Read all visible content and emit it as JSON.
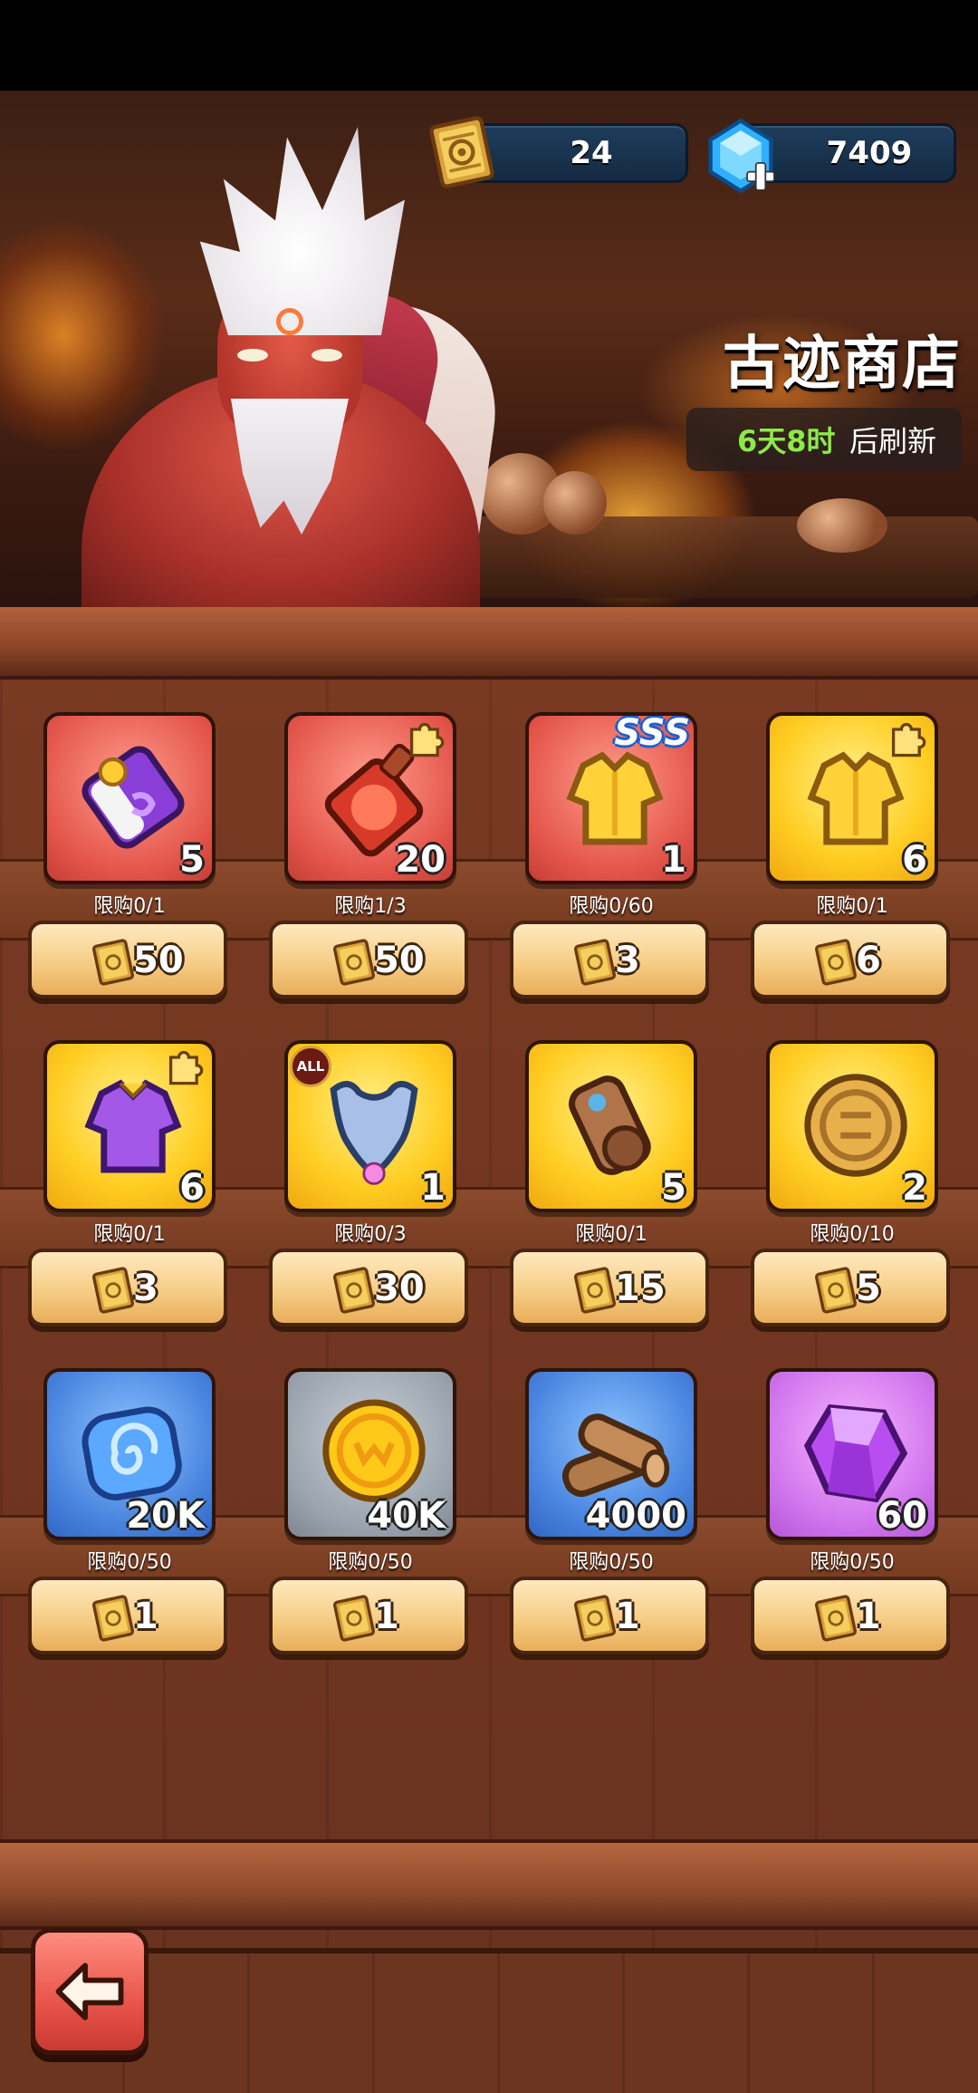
{
  "currency": {
    "tickets": "24",
    "gems": "7409",
    "ticket_icon": "relic-ticket-icon",
    "gem_icon": "blue-gem-icon"
  },
  "shop": {
    "title": "古迹商店",
    "refresh_time": "6天8时",
    "refresh_label": "后刷新"
  },
  "items": [
    {
      "qty": "5",
      "limit": "限购0/1",
      "price": "50",
      "icon": "purple-scroll-icon"
    },
    {
      "qty": "20",
      "limit": "限购1/3",
      "price": "50",
      "icon": "red-potion-shard-icon"
    },
    {
      "qty": "1",
      "limit": "限购0/60",
      "price": "3",
      "icon": "gold-armor-shard-icon",
      "badge": "SSS"
    },
    {
      "qty": "6",
      "limit": "限购0/1",
      "price": "6",
      "icon": "gold-armor-shard-icon"
    },
    {
      "qty": "6",
      "limit": "限购0/1",
      "price": "3",
      "icon": "purple-armor-shard-icon"
    },
    {
      "qty": "1",
      "limit": "限购0/3",
      "price": "30",
      "icon": "blue-armor-icon",
      "badge": "ALL"
    },
    {
      "qty": "5",
      "limit": "限购0/1",
      "price": "15",
      "icon": "brown-scroll-icon"
    },
    {
      "qty": "2",
      "limit": "限购0/10",
      "price": "5",
      "icon": "gold-coin-icon"
    },
    {
      "qty": "20K",
      "limit": "限购0/50",
      "price": "1",
      "icon": "blue-swirl-stone-icon"
    },
    {
      "qty": "40K",
      "limit": "限购0/50",
      "price": "1",
      "icon": "gold-coin-icon"
    },
    {
      "qty": "4000",
      "limit": "限购0/50",
      "price": "1",
      "icon": "wood-log-icon"
    },
    {
      "qty": "60",
      "limit": "限购0/50",
      "price": "1",
      "icon": "purple-crystal-icon"
    }
  ],
  "back_button": {
    "icon": "arrow-left-icon"
  }
}
